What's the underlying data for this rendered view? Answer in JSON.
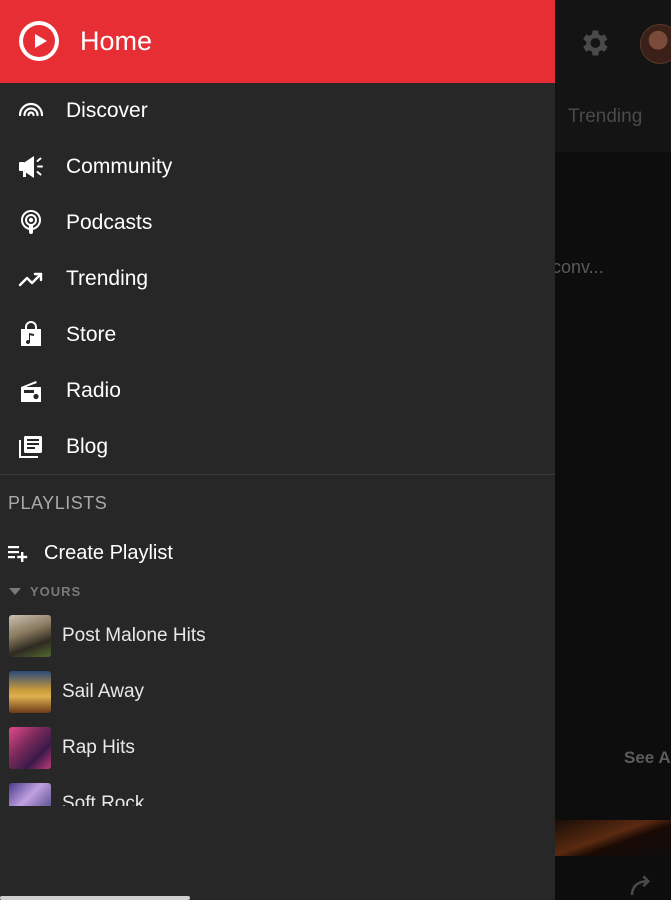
{
  "drawer": {
    "title": "Home",
    "nav_items": [
      {
        "label": "Discover",
        "icon": "rainbow-icon"
      },
      {
        "label": "Community",
        "icon": "megaphone-icon"
      },
      {
        "label": "Podcasts",
        "icon": "podcast-icon"
      },
      {
        "label": "Trending",
        "icon": "trending-icon"
      },
      {
        "label": "Store",
        "icon": "shopping-bag-icon"
      },
      {
        "label": "Radio",
        "icon": "radio-icon"
      },
      {
        "label": "Blog",
        "icon": "newspaper-icon"
      }
    ],
    "playlists_heading": "PLAYLISTS",
    "create_playlist": "Create Playlist",
    "yours_label": "YOURS",
    "playlists": [
      {
        "name": "Post Malone Hits"
      },
      {
        "name": "Sail Away"
      },
      {
        "name": "Rap Hits"
      },
      {
        "name": "Soft Rock"
      }
    ]
  },
  "background": {
    "tab_trending": "Trending",
    "snippet": "conv...",
    "see_all": "See A"
  },
  "colors": {
    "accent": "#e62e34",
    "drawer_bg": "#272727",
    "app_bg": "#0d0d0d"
  }
}
